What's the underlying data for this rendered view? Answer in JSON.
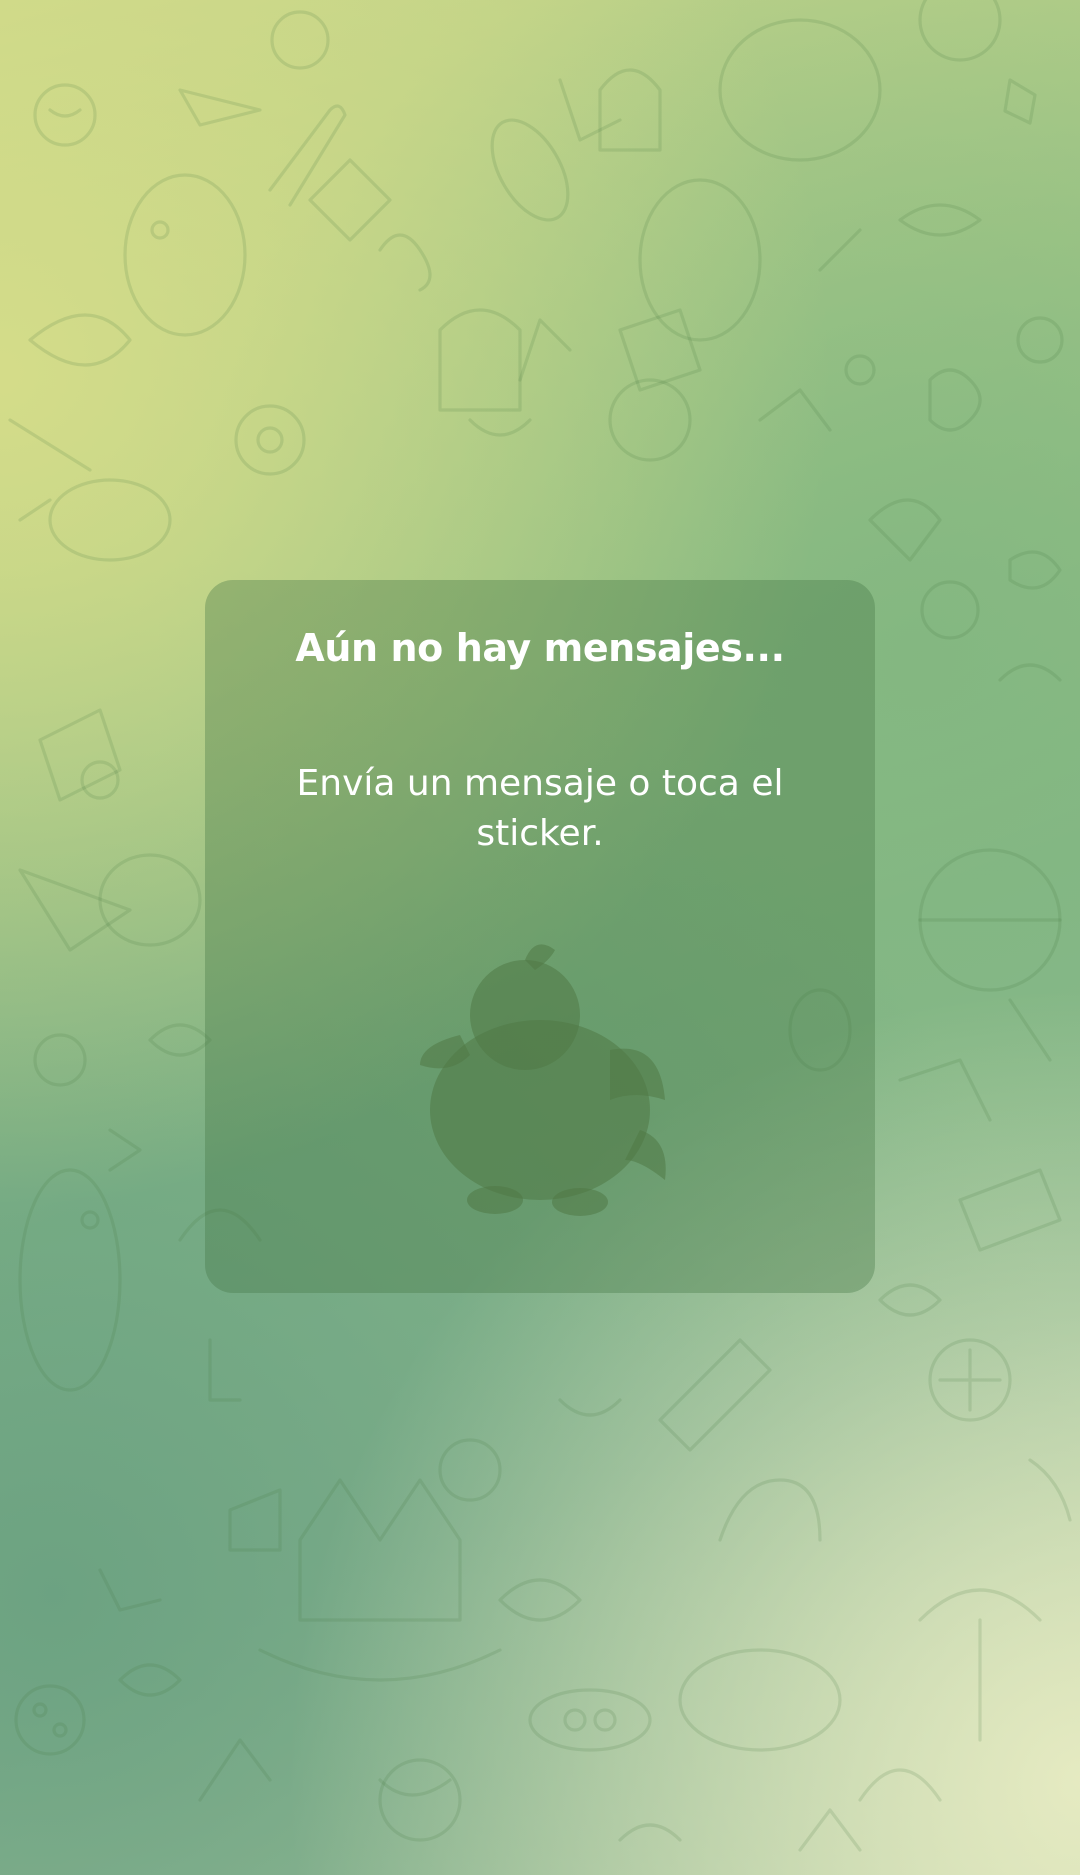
{
  "empty_state": {
    "title": "Aún no hay mensajes...",
    "subtitle": "Envía un mensaje o toca el sticker.",
    "sticker_icon": "duck-sticker-icon"
  },
  "wallpaper": {
    "pattern": "doodle-pattern",
    "colors": [
      "#c9d689",
      "#9cc587",
      "#84b888",
      "#b6cda6",
      "#e3e8c5"
    ]
  },
  "card_color": "#6b9a6b"
}
